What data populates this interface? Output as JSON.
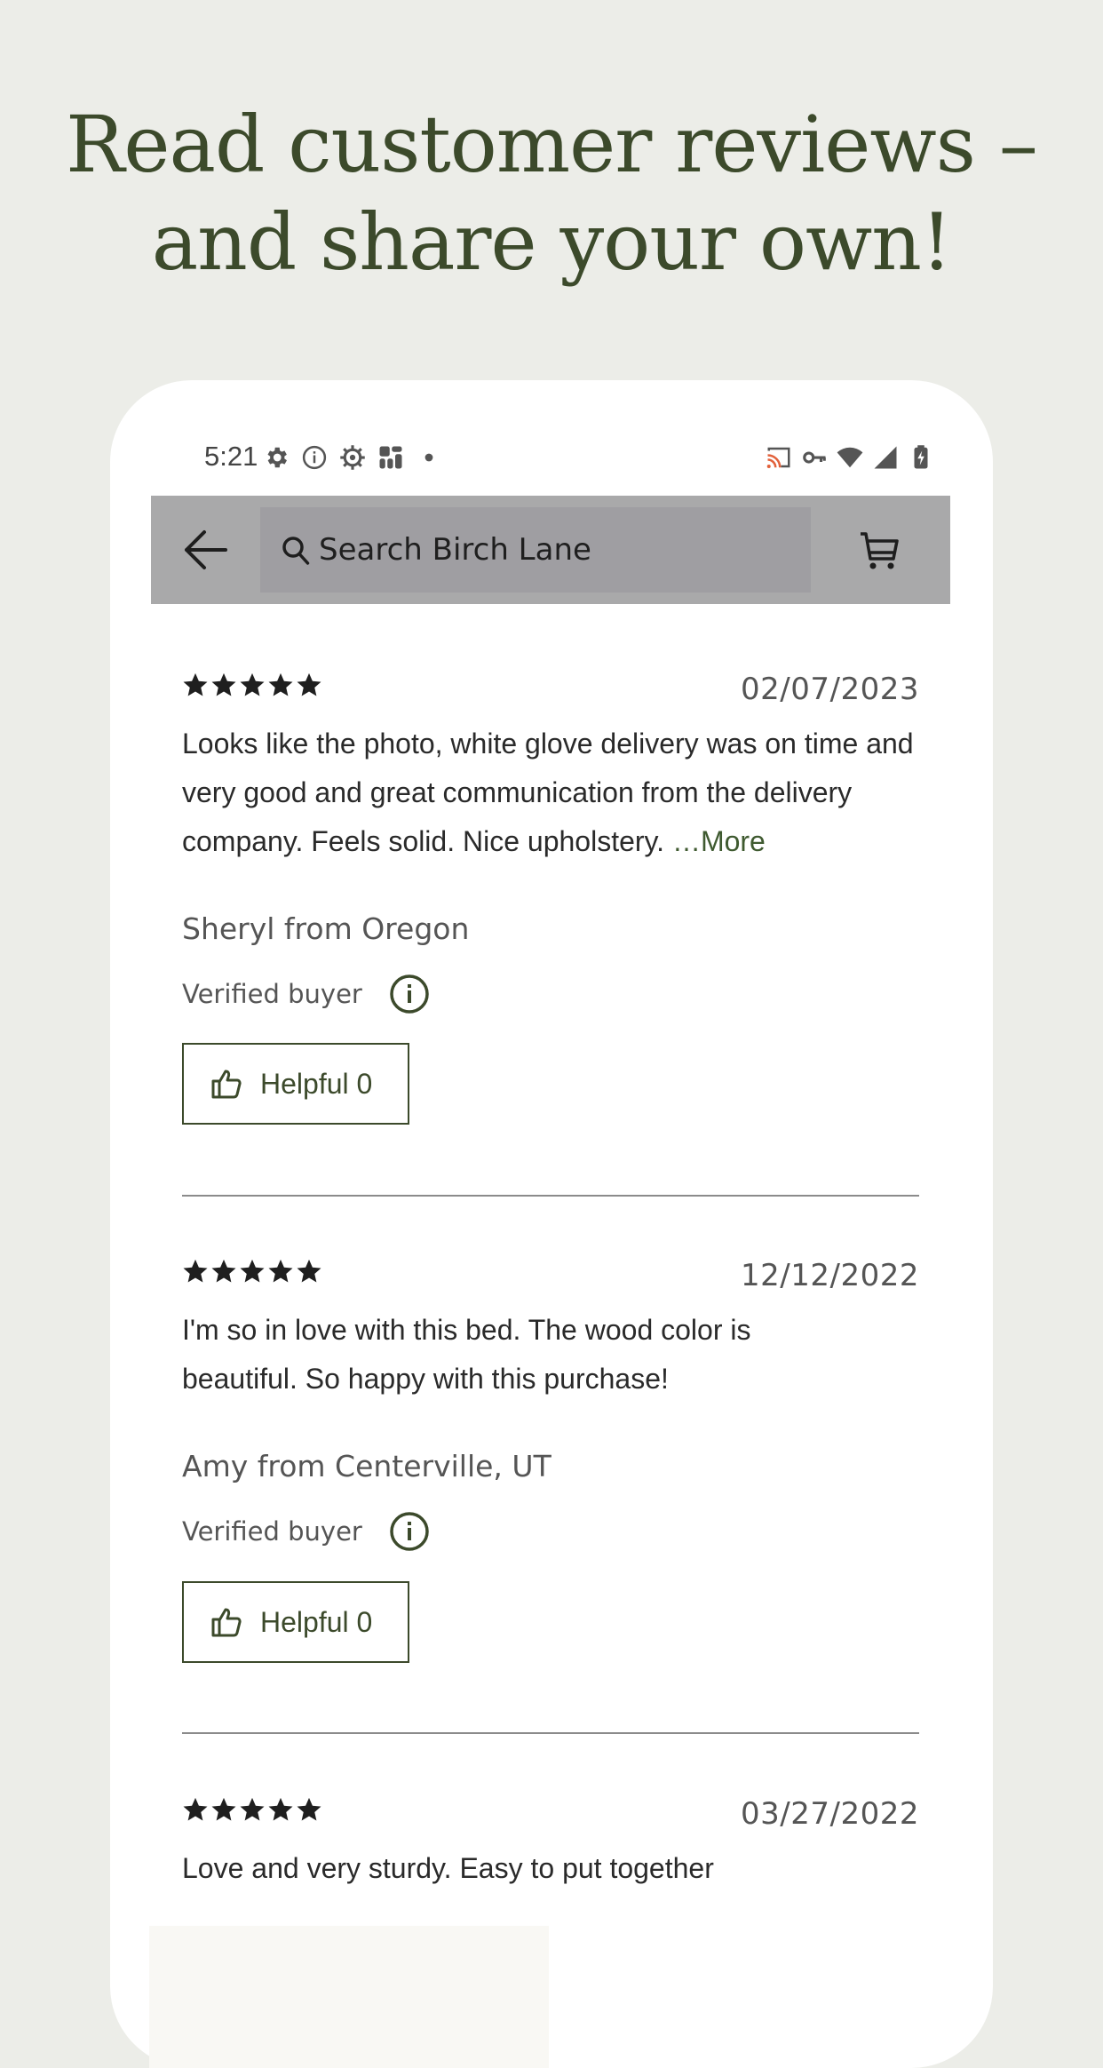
{
  "headline": {
    "line1": "Read customer reviews –",
    "line2": "and share your own!"
  },
  "status_bar": {
    "time": "5:21",
    "left_icons": [
      "settings-gear-icon",
      "info-circle-icon",
      "settings-alt-icon",
      "wayfair-app-icon",
      "dot-icon"
    ],
    "right_icons": [
      "cast-icon",
      "vpn-key-icon",
      "wifi-icon",
      "cellular-signal-icon",
      "battery-charging-icon"
    ]
  },
  "toolbar": {
    "back_icon": "arrow-left-icon",
    "search_placeholder": "Search Birch Lane",
    "cart_icon": "shopping-cart-icon"
  },
  "reviews": [
    {
      "rating": 5,
      "date": "02/07/2023",
      "text": "Looks like the photo, white glove delivery was on time and very good and great communication from the delivery company. Feels solid. Nice upholstery.",
      "more_label": "…More",
      "author": "Sheryl from Oregon",
      "verified_label": "Verified buyer",
      "helpful_label": "Helpful 0"
    },
    {
      "rating": 5,
      "date": "12/12/2022",
      "text": "I'm so in love with this bed. The wood color is beautiful. So happy with this purchase!",
      "author": "Amy from Centerville, UT",
      "verified_label": "Verified buyer",
      "helpful_label": "Helpful 0"
    },
    {
      "rating": 5,
      "date": "03/27/2022",
      "text": "Love and very sturdy. Easy to put together"
    }
  ],
  "colors": {
    "background": "#ecede8",
    "brand_green": "#3c4a2b",
    "toolbar_gray": "#a9a9aa"
  }
}
